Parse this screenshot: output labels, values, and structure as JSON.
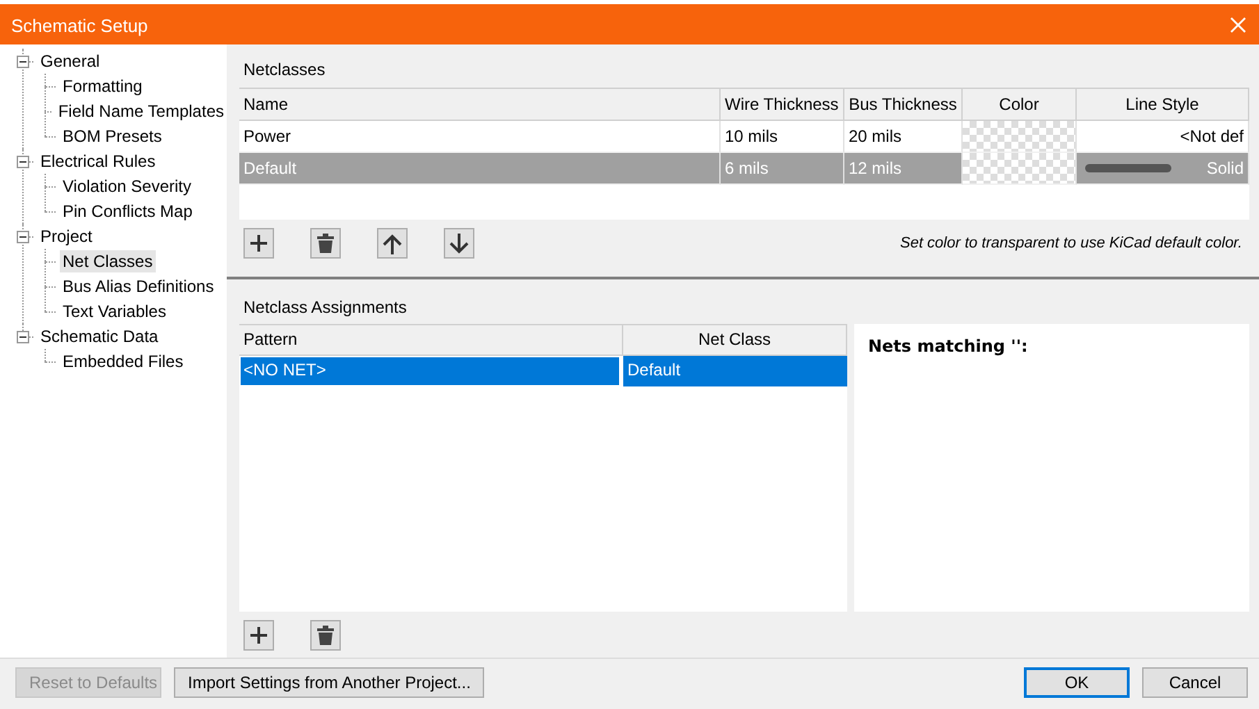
{
  "window": {
    "title": "Schematic Setup"
  },
  "sidebar": {
    "items": [
      {
        "label": "General",
        "expanded": true,
        "selected": false,
        "children": [
          {
            "label": "Formatting",
            "selected": false
          },
          {
            "label": "Field Name Templates",
            "selected": false
          },
          {
            "label": "BOM Presets",
            "selected": false
          }
        ]
      },
      {
        "label": "Electrical Rules",
        "expanded": true,
        "selected": false,
        "children": [
          {
            "label": "Violation Severity",
            "selected": false
          },
          {
            "label": "Pin Conflicts Map",
            "selected": false
          }
        ]
      },
      {
        "label": "Project",
        "expanded": true,
        "selected": false,
        "children": [
          {
            "label": "Net Classes",
            "selected": true
          },
          {
            "label": "Bus Alias Definitions",
            "selected": false
          },
          {
            "label": "Text Variables",
            "selected": false
          }
        ]
      },
      {
        "label": "Schematic Data",
        "expanded": true,
        "selected": false,
        "children": [
          {
            "label": "Embedded Files",
            "selected": false
          }
        ]
      }
    ]
  },
  "netclasses": {
    "title": "Netclasses",
    "columns": [
      "Name",
      "Wire Thickness",
      "Bus Thickness",
      "Color",
      "Line Style"
    ],
    "rows": [
      {
        "name": "Power",
        "wire": "10 mils",
        "bus": "20 mils",
        "line_style": "<Not def",
        "line_sample": false,
        "selected": false
      },
      {
        "name": "Default",
        "wire": "6 mils",
        "bus": "12 mils",
        "line_style": "Solid",
        "line_sample": true,
        "selected": true
      }
    ],
    "buttons": [
      {
        "kind": "add"
      },
      {
        "kind": "delete"
      },
      {
        "kind": "up"
      },
      {
        "kind": "down"
      }
    ],
    "note": "Set color to transparent to use KiCad default color."
  },
  "assignments": {
    "title": "Netclass Assignments",
    "columns": [
      "Pattern",
      "Net Class"
    ],
    "rows": [
      {
        "pattern": "<NO NET>",
        "net_class": "Default",
        "selected": true
      }
    ],
    "buttons": [
      {
        "kind": "add"
      },
      {
        "kind": "delete"
      }
    ],
    "matching_title": "Nets matching '':"
  },
  "footer": {
    "left_buttons": [
      {
        "label": "Reset to Defaults",
        "disabled": true,
        "default": false
      },
      {
        "label": "Import Settings from Another Project...",
        "disabled": false,
        "default": false
      }
    ],
    "right_buttons": [
      {
        "label": "OK",
        "disabled": false,
        "default": true
      },
      {
        "label": "Cancel",
        "disabled": false,
        "default": false
      }
    ]
  }
}
